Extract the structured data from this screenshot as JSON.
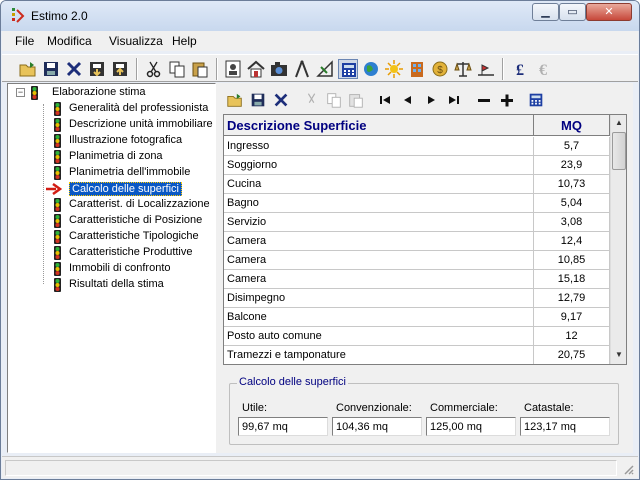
{
  "window": {
    "title": "Estimo 2.0"
  },
  "menu": [
    "File",
    "Modifica",
    "Visualizza",
    "Help"
  ],
  "toolbar_icons": [
    "open-folder-icon",
    "save-icon",
    "delete-icon",
    "import-icon",
    "export-icon",
    "cut-icon",
    "copy-icon",
    "paste-icon",
    "professional-icon",
    "house-icon",
    "camera-icon",
    "compass-icon",
    "drafting-icon",
    "calculator-icon",
    "globe-icon",
    "sun-icon",
    "building-icon",
    "coin-icon",
    "scales-icon",
    "land-icon",
    "pound-icon",
    "euro-icon"
  ],
  "tree": {
    "root": "Elaborazione stima",
    "items": [
      {
        "label": "Generalità del professionista"
      },
      {
        "label": "Descrizione unità immobiliare"
      },
      {
        "label": "Illustrazione fotografica"
      },
      {
        "label": "Planimetria di zona"
      },
      {
        "label": "Planimetria dell'immobile"
      },
      {
        "label": "Calcolo delle superfici",
        "selected": true
      },
      {
        "label": "Caratterist. di Localizzazione"
      },
      {
        "label": "Caratteristiche di Posizione"
      },
      {
        "label": "Caratteristiche Tipologiche"
      },
      {
        "label": "Caratteristiche Produttive"
      },
      {
        "label": "Immobili di confronto"
      },
      {
        "label": "Risultati della stima"
      }
    ]
  },
  "grid": {
    "headers": {
      "desc": "Descrizione Superficie",
      "mq": "MQ"
    },
    "rows": [
      {
        "desc": "Ingresso",
        "mq": "5,7"
      },
      {
        "desc": "Soggiorno",
        "mq": "23,9"
      },
      {
        "desc": "Cucina",
        "mq": "10,73"
      },
      {
        "desc": "Bagno",
        "mq": "5,04"
      },
      {
        "desc": "Servizio",
        "mq": "3,08"
      },
      {
        "desc": "Camera",
        "mq": "12,4"
      },
      {
        "desc": "Camera",
        "mq": "10,85"
      },
      {
        "desc": "Camera",
        "mq": "15,18"
      },
      {
        "desc": "Disimpegno",
        "mq": "12,79"
      },
      {
        "desc": "Balcone",
        "mq": "9,17"
      },
      {
        "desc": "Posto auto comune",
        "mq": "12"
      },
      {
        "desc": "Tramezzi e tamponature",
        "mq": "20,75"
      }
    ]
  },
  "summary": {
    "title": "Calcolo delle superfici",
    "utile": {
      "label": "Utile:",
      "value": "99,67  mq"
    },
    "convenzionale": {
      "label": "Convenzionale:",
      "value": "104,36  mq"
    },
    "commerciale": {
      "label": "Commerciale:",
      "value": "125,00  mq"
    },
    "catastale": {
      "label": "Catastale:",
      "value": "123,17  mq"
    }
  }
}
